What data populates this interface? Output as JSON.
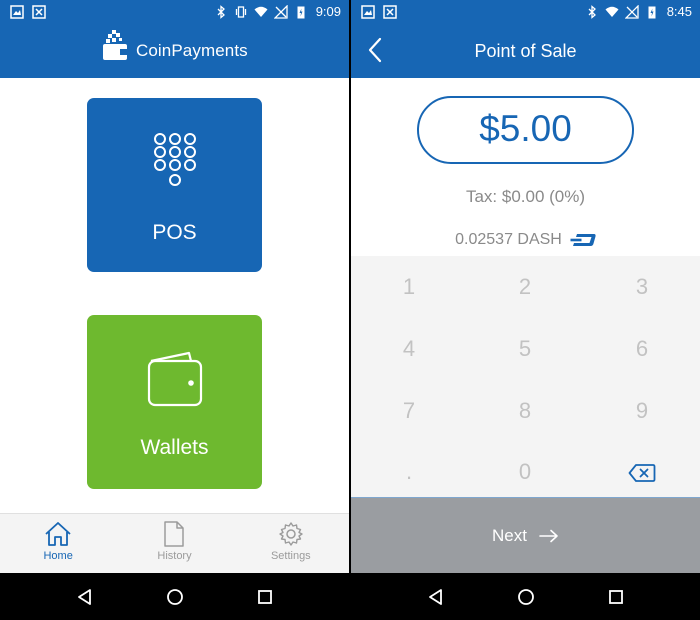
{
  "left": {
    "status": {
      "time": "9:09"
    },
    "app": {
      "logo_text": "CoinPayments"
    },
    "tiles": {
      "pos_label": "POS",
      "wallets_label": "Wallets"
    },
    "nav": {
      "home": "Home",
      "history": "History",
      "settings": "Settings"
    }
  },
  "right": {
    "status": {
      "time": "8:45"
    },
    "app": {
      "title": "Point of Sale"
    },
    "amount": "$5.00",
    "tax": "Tax: $0.00 (0%)",
    "crypto_amount": "0.02537 DASH",
    "keys": [
      "1",
      "2",
      "3",
      "4",
      "5",
      "6",
      "7",
      "8",
      "9",
      ".",
      "0"
    ],
    "next_label": "Next"
  },
  "colors": {
    "primary": "#1766b4",
    "wallets_green": "#6eb92f",
    "keypad_bg": "#f4f4f4",
    "next_bg": "#9a9da1"
  }
}
